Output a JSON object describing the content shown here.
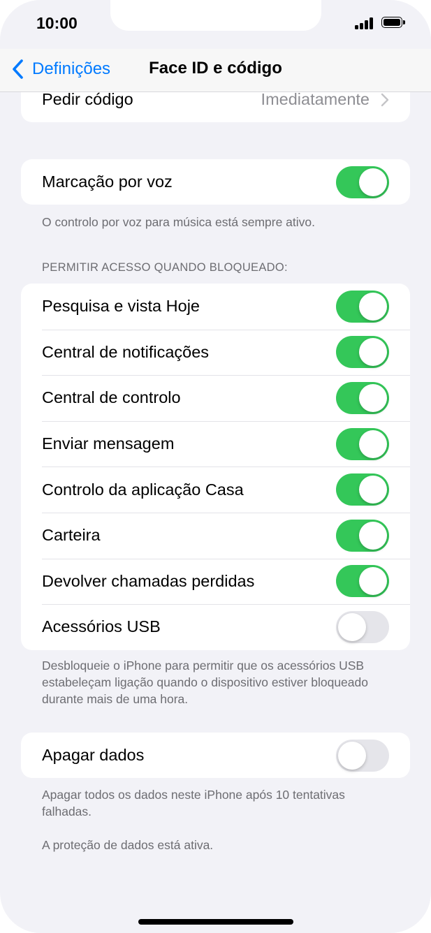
{
  "status_bar": {
    "time": "10:00"
  },
  "nav": {
    "back_label": "Definições",
    "title": "Face ID e código"
  },
  "require_passcode": {
    "label": "Pedir código",
    "value": "Imediatamente"
  },
  "voice_dial": {
    "label": "Marcação por voz",
    "on": true,
    "footer": "O controlo por voz para música está sempre ativo."
  },
  "locked_access": {
    "header": "PERMITIR ACESSO QUANDO BLOQUEADO:",
    "items": [
      {
        "label": "Pesquisa e vista Hoje",
        "on": true
      },
      {
        "label": "Central de notificações",
        "on": true
      },
      {
        "label": "Central de controlo",
        "on": true
      },
      {
        "label": "Enviar mensagem",
        "on": true
      },
      {
        "label": "Controlo da aplicação Casa",
        "on": true
      },
      {
        "label": "Carteira",
        "on": true
      },
      {
        "label": "Devolver chamadas perdidas",
        "on": true
      },
      {
        "label": "Acessórios USB",
        "on": false
      }
    ],
    "footer": "Desbloqueie o iPhone para permitir que os acessórios USB estabeleçam ligação quando o dispositivo estiver bloqueado durante mais de uma hora."
  },
  "erase_data": {
    "label": "Apagar dados",
    "on": false,
    "footer1": "Apagar todos os dados neste iPhone após 10 tentativas falhadas.",
    "footer2": "A proteção de dados está ativa."
  },
  "colors": {
    "accent": "#007aff",
    "toggle_on": "#34c759",
    "toggle_off": "#e5e5ea",
    "background": "#f2f2f7"
  }
}
